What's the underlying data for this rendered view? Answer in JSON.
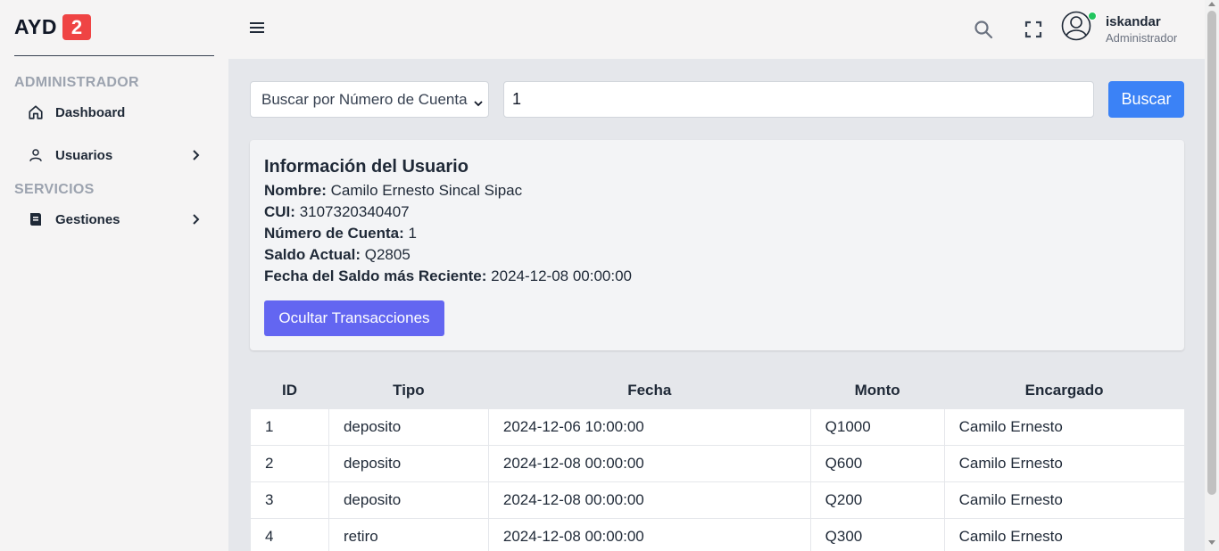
{
  "logo": {
    "text": "AYD",
    "badge": "2"
  },
  "sidebar": {
    "sections": [
      {
        "title": "ADMINISTRADOR"
      },
      {
        "title": "SERVICIOS"
      }
    ],
    "items": [
      {
        "label": "Dashboard",
        "icon": "home-icon"
      },
      {
        "label": "Usuarios",
        "icon": "user-icon"
      },
      {
        "label": "Gestiones",
        "icon": "database-icon"
      }
    ]
  },
  "header": {
    "user_name": "iskandar",
    "user_role": "Administrador"
  },
  "search": {
    "select_value": "Buscar por Número de Cuenta",
    "input_value": "1",
    "button_label": "Buscar"
  },
  "user_info": {
    "title": "Información del Usuario",
    "nombre_label": "Nombre:",
    "nombre": "Camilo Ernesto Sincal Sipac",
    "cui_label": "CUI:",
    "cui": "3107320340407",
    "cuenta_label": "Número de Cuenta:",
    "cuenta": "1",
    "saldo_label": "Saldo Actual:",
    "saldo": "Q2805",
    "fecha_label": "Fecha del Saldo más Reciente:",
    "fecha": "2024-12-08 00:00:00",
    "toggle_label": "Ocultar Transacciones"
  },
  "table": {
    "headers": [
      "ID",
      "Tipo",
      "Fecha",
      "Monto",
      "Encargado"
    ],
    "rows": [
      [
        "1",
        "deposito",
        "2024-12-06 10:00:00",
        "Q1000",
        "Camilo Ernesto"
      ],
      [
        "2",
        "deposito",
        "2024-12-08 00:00:00",
        "Q600",
        "Camilo Ernesto"
      ],
      [
        "3",
        "deposito",
        "2024-12-08 00:00:00",
        "Q200",
        "Camilo Ernesto"
      ],
      [
        "4",
        "retiro",
        "2024-12-08 00:00:00",
        "Q300",
        "Camilo Ernesto"
      ]
    ]
  },
  "colors": {
    "primary_button": "#3b82f6",
    "toggle_button": "#6366f1",
    "logo_badge": "#ef4444",
    "online": "#22c55e"
  }
}
